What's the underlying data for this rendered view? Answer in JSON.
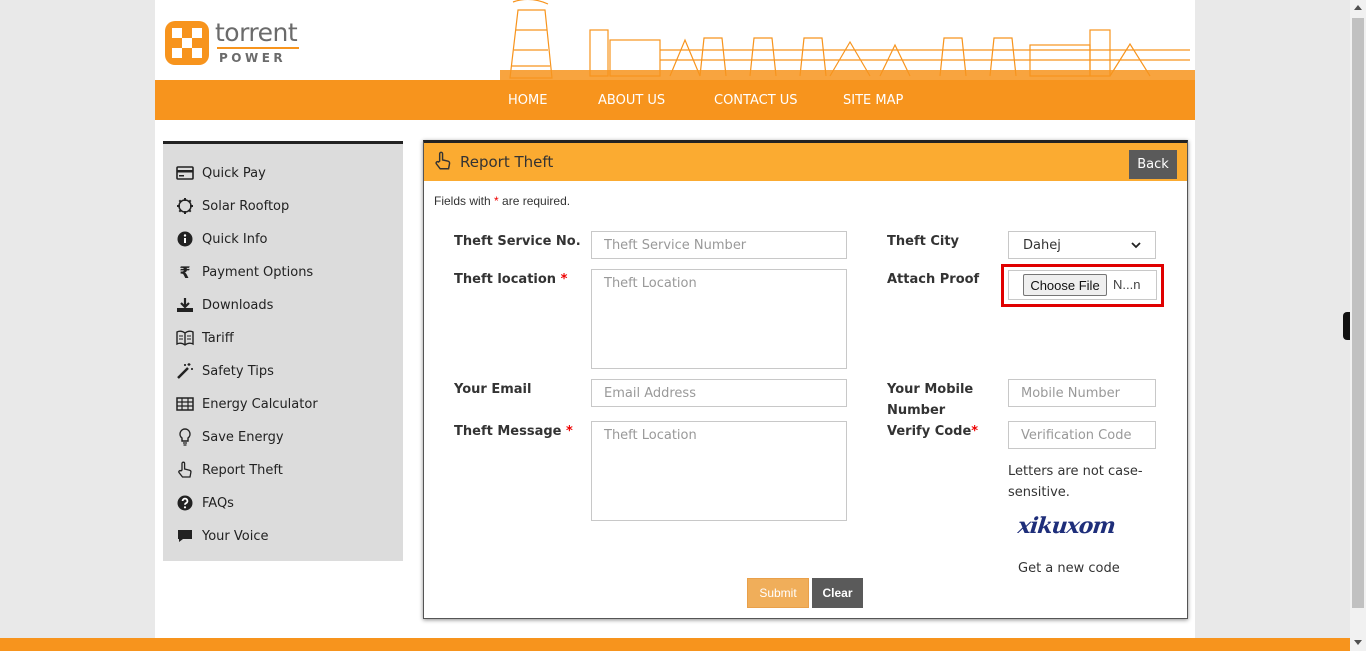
{
  "brand": {
    "name": "torrent",
    "sub": "POWER",
    "accent": "#f7941d"
  },
  "nav": [
    "HOME",
    "ABOUT US",
    "CONTACT US",
    "SITE MAP"
  ],
  "sidebar": [
    {
      "label": "Quick Pay",
      "icon": "credit-card-icon"
    },
    {
      "label": "Solar Rooftop",
      "icon": "gear-icon"
    },
    {
      "label": "Quick Info",
      "icon": "info-icon"
    },
    {
      "label": "Payment Options",
      "icon": "rupee-icon"
    },
    {
      "label": "Downloads",
      "icon": "download-icon"
    },
    {
      "label": "Tariff",
      "icon": "book-icon"
    },
    {
      "label": "Safety Tips",
      "icon": "magic-wand-icon"
    },
    {
      "label": "Energy Calculator",
      "icon": "table-icon"
    },
    {
      "label": "Save Energy",
      "icon": "lightbulb-icon"
    },
    {
      "label": "Report Theft",
      "icon": "pointing-hand-icon"
    },
    {
      "label": "FAQs",
      "icon": "question-icon"
    },
    {
      "label": "Your Voice",
      "icon": "comment-icon"
    }
  ],
  "panel": {
    "title": "Report Theft",
    "back": "Back",
    "required_note_before": "Fields with ",
    "required_star": "*",
    "required_note_after": " are required."
  },
  "form": {
    "service_no": {
      "label": "Theft Service No.",
      "placeholder": "Theft Service Number"
    },
    "location": {
      "label": "Theft location",
      "placeholder": "Theft Location"
    },
    "email": {
      "label": "Your Email",
      "placeholder": "Email Address"
    },
    "message": {
      "label": "Theft Message",
      "placeholder": "Theft Location"
    },
    "city": {
      "label": "Theft City",
      "value": "Dahej"
    },
    "proof": {
      "label": "Attach Proof",
      "button": "Choose File",
      "filename": "N...n"
    },
    "mobile": {
      "label": "Your Mobile Number",
      "placeholder": "Mobile Number"
    },
    "verify": {
      "label": "Verify Code",
      "placeholder": "Verification Code"
    },
    "note": "Letters are not case-sensitive.",
    "captcha": "xikuxom",
    "new_code": "Get a new code",
    "submit": "Submit",
    "clear": "Clear",
    "star": "*"
  }
}
